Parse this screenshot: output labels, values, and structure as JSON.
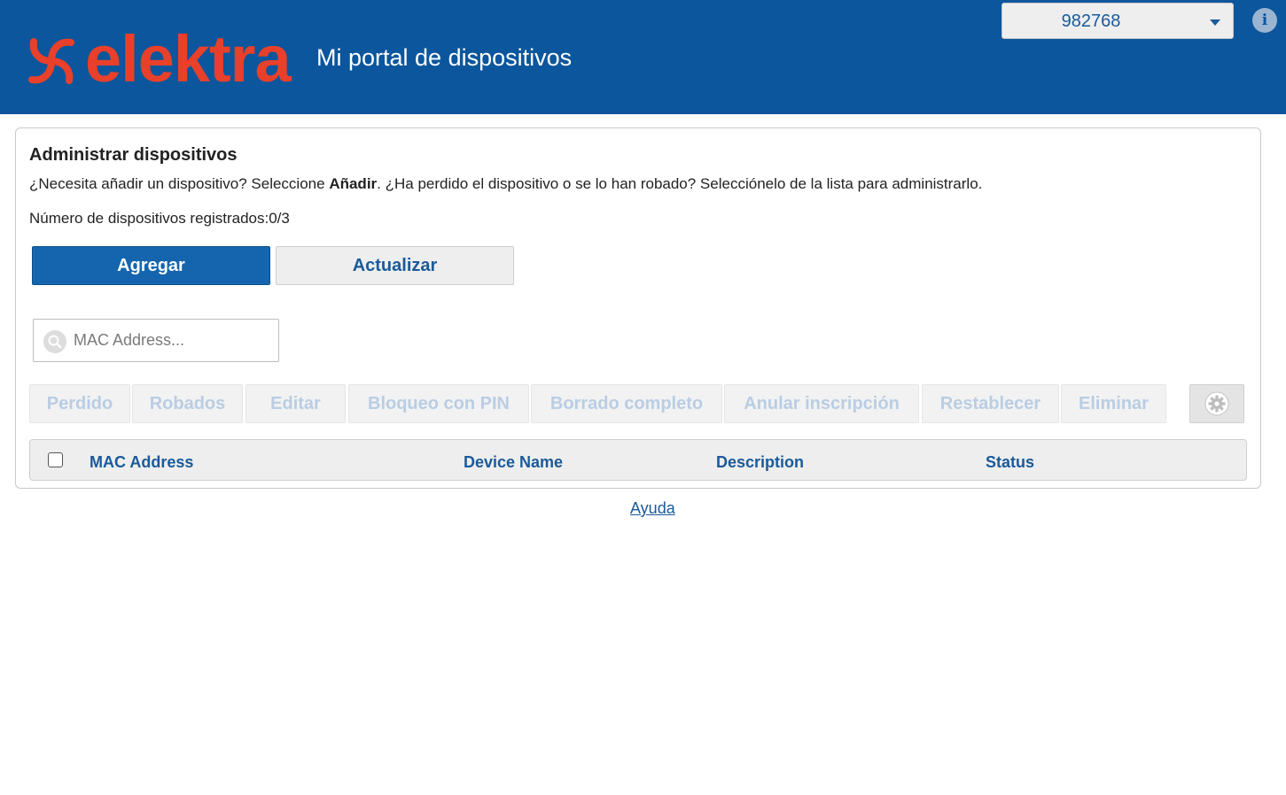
{
  "header": {
    "brand": "elektra",
    "title": "Mi portal de dispositivos",
    "user_select_value": "982768",
    "info_icon": "info-icon",
    "background_color": "#0b569c",
    "brand_color": "#e8402b"
  },
  "panel": {
    "title": "Administrar dispositivos",
    "intro_part1": "¿Necesita añadir un dispositivo? Seleccione ",
    "intro_bold": "Añadir",
    "intro_part2": ". ¿Ha perdido el dispositivo o se lo han robado? Selecciónelo de la lista para administrarlo.",
    "count_text": "Número de dispositivos registrados:0/3",
    "add_label": "Agregar",
    "refresh_label": "Actualizar",
    "search_placeholder": "MAC Address...",
    "actions": {
      "lost": "Perdido",
      "stolen": "Robados",
      "edit": "Editar",
      "pin_lock": "Bloqueo con PIN",
      "full_wipe": "Borrado completo",
      "unenroll": "Anular inscripción",
      "reset": "Restablecer",
      "delete": "Eliminar"
    },
    "settings_icon": "gear-icon"
  },
  "table": {
    "columns": [
      "MAC Address",
      "Device Name",
      "Description",
      "Status"
    ],
    "rows": []
  },
  "footer": {
    "help_link": "Ayuda"
  }
}
